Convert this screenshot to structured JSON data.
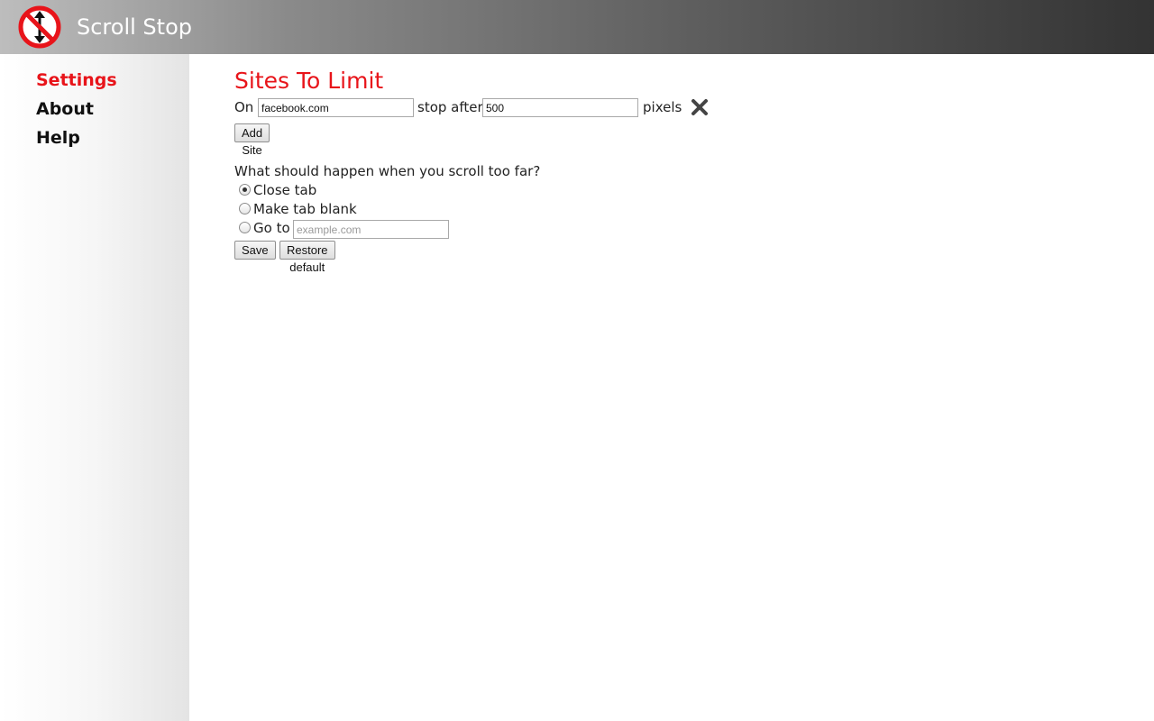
{
  "app": {
    "title": "Scroll Stop",
    "logo_icon": "no-scroll-icon",
    "accent_color": "#e8141a"
  },
  "sidebar": {
    "items": [
      {
        "label": "Settings",
        "active": true
      },
      {
        "label": "About",
        "active": false
      },
      {
        "label": "Help",
        "active": false
      }
    ]
  },
  "main": {
    "heading": "Sites To Limit",
    "site_rule": {
      "on_label": "On",
      "site_value": "facebook.com",
      "stop_after_label": "stop after",
      "pixels_value": "500",
      "pixels_label": "pixels",
      "remove_icon": "close-x-icon"
    },
    "add_site_label": "Add Site",
    "question": "What should happen when you scroll too far?",
    "options": [
      {
        "label": "Close tab",
        "checked": true
      },
      {
        "label": "Make tab blank",
        "checked": false
      },
      {
        "label": "Go to",
        "checked": false
      }
    ],
    "goto_placeholder": "example.com",
    "save_label": "Save",
    "restore_label": "Restore default"
  }
}
